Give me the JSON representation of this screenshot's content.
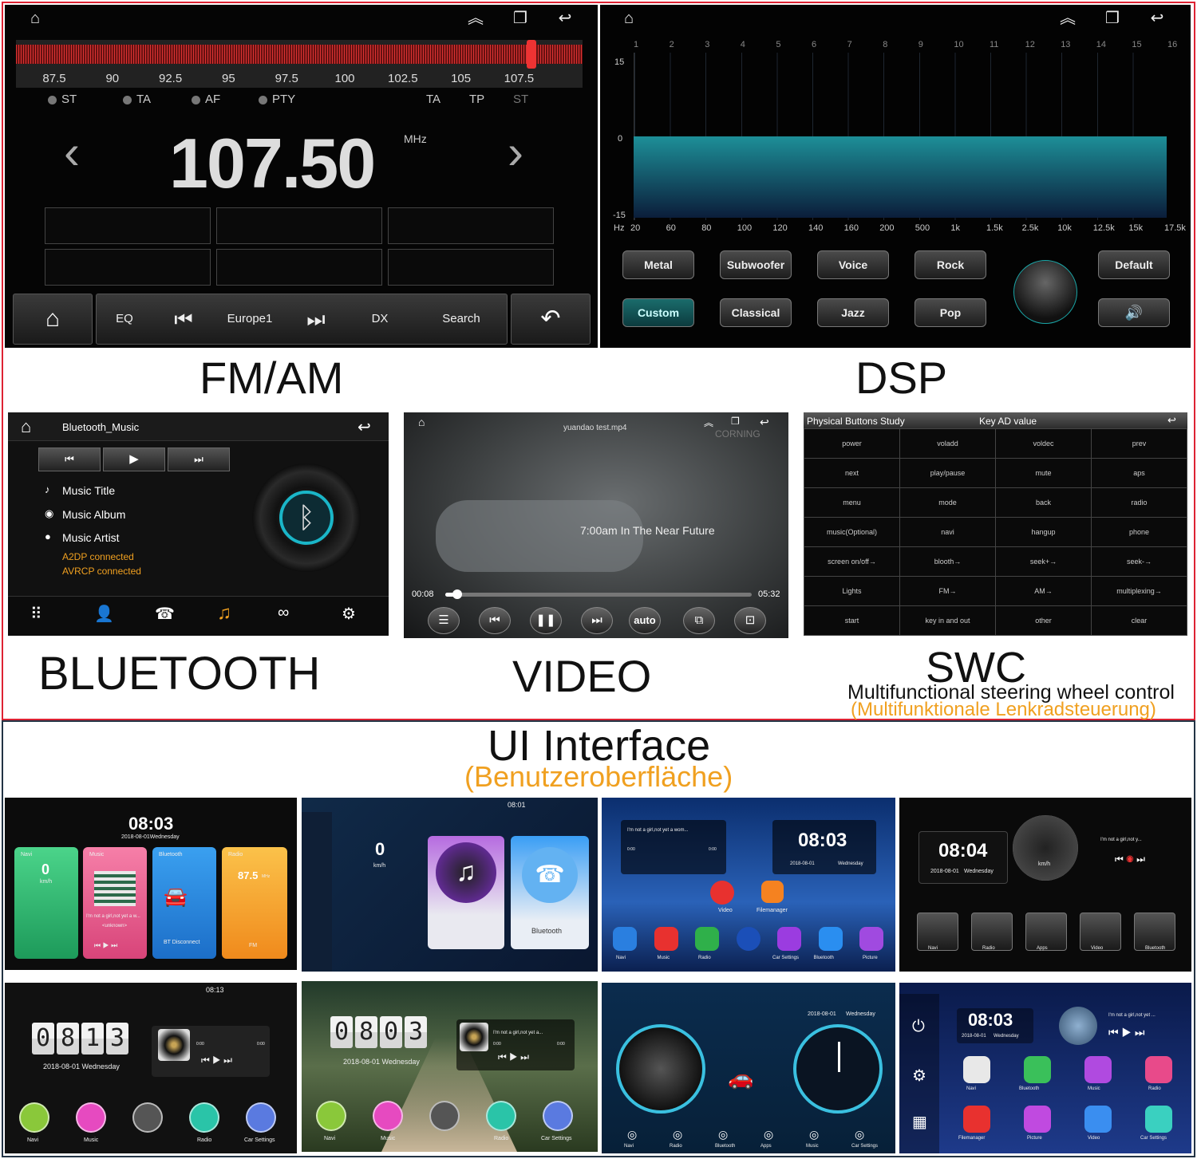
{
  "captions": {
    "fm": "FM/AM",
    "dsp": "DSP",
    "bluetooth": "BLUETOOTH",
    "video": "VIDEO",
    "swc": "SWC",
    "swc_sub": "Multifunctional steering wheel control",
    "swc_sub_de": "(Multifunktionale Lenkradsteuerung)",
    "ui": "UI Interface",
    "ui_de": "(Benutzeroberfläche)"
  },
  "fm": {
    "scale": [
      "87.5",
      "90",
      "92.5",
      "95",
      "97.5",
      "100",
      "102.5",
      "105",
      "107.5"
    ],
    "flags_left": [
      "ST",
      "TA",
      "AF",
      "PTY"
    ],
    "flags_right": [
      "TA",
      "TP",
      "ST"
    ],
    "frequency": "107.50",
    "unit": "MHz",
    "buttons": {
      "eq": "EQ",
      "station": "Europe1",
      "dx": "DX",
      "search": "Search"
    },
    "tuned_fraction": 0.91
  },
  "dsp": {
    "bands": [
      "1",
      "2",
      "3",
      "4",
      "5",
      "6",
      "7",
      "8",
      "9",
      "10",
      "11",
      "12",
      "13",
      "14",
      "15",
      "16"
    ],
    "levels": [
      "15",
      "0",
      "-15"
    ],
    "hz_label": "Hz",
    "freqs": [
      "20",
      "60",
      "80",
      "100",
      "120",
      "140",
      "160",
      "200",
      "500",
      "1k",
      "1.5k",
      "2.5k",
      "10k",
      "12.5k",
      "15k",
      "17.5k"
    ],
    "presets_row1": [
      "Metal",
      "Subwoofer",
      "Voice",
      "Rock"
    ],
    "presets_row2": [
      "Custom",
      "Classical",
      "Jazz",
      "Pop"
    ],
    "default": "Default"
  },
  "bt": {
    "title": "Bluetooth_Music",
    "music_title": "Music Title",
    "music_album": "Music Album",
    "music_artist": "Music Artist",
    "status1": "A2DP connected",
    "status2": "AVRCP connected"
  },
  "video": {
    "file": "yuandao test.mp4",
    "watermark": "CORNING",
    "subtitle": "7:00am In The Near Future",
    "elapsed": "00:08",
    "total": "05:32",
    "auto": "auto",
    "progress": 0.04
  },
  "swc": {
    "header_left": "Physical Buttons Study",
    "header_mid": "Key AD value",
    "rows": [
      [
        "power",
        "voladd",
        "voldec",
        "prev"
      ],
      [
        "next",
        "play/pause",
        "mute",
        "aps"
      ],
      [
        "menu",
        "mode",
        "back",
        "radio"
      ],
      [
        "music(Optional)",
        "navi",
        "hangup",
        "phone"
      ],
      [
        "screen on/off→",
        "blooth→",
        "seek+→",
        "seek-→"
      ],
      [
        "Lights",
        "FM→",
        "AM→",
        "multiplexing→"
      ],
      [
        "start",
        "key in and out",
        "other",
        "clear"
      ]
    ]
  },
  "thumbs": {
    "t1": {
      "time": "08:03",
      "date": "2018-08-01Wednesday",
      "cards": [
        "Navi",
        "Music",
        "Bluetooth",
        "Radio"
      ],
      "speed": "0",
      "speed_unit": "km/h",
      "song": "I'm not a girl,not yet a w...",
      "artist": "<unknown>",
      "bt_status": "BT Disconnect",
      "radio_freq": "87.5",
      "radio_unit": "MHz",
      "fm": "FM"
    },
    "t2": {
      "time": "08:01",
      "speed": "0",
      "speed_unit": "km/h",
      "bt": "Bluetooth"
    },
    "t3": {
      "song": "I'm not a girl,not yet a wom...",
      "t0": "0:00",
      "t1": "0:00",
      "time": "08:03",
      "date": "2018-08-01",
      "day": "Wednesday",
      "top": [
        "Video",
        "Filemanager"
      ],
      "dock": [
        "Navi",
        "Music",
        "Radio",
        "",
        "Car Settings",
        "Bluetooth",
        "Picture"
      ]
    },
    "t4": {
      "time": "08:04",
      "date": "2018-08-01",
      "day": "Wednesday",
      "song": "I'm not a girl,not y...",
      "unit": "km/h",
      "dock": [
        "Navi",
        "Radio",
        "Apps",
        "Video",
        "Bluetooth"
      ]
    },
    "t5": {
      "time": "08:13",
      "clock": [
        "0",
        "8",
        "1",
        "3"
      ],
      "date": "2018-08-01 Wednesday",
      "t0": "0:00",
      "t1": "0:00",
      "dock": [
        "Navi",
        "Music",
        "",
        "Radio",
        "Car Settings"
      ]
    },
    "t6": {
      "clock": [
        "0",
        "8",
        "0",
        "3"
      ],
      "date": "2018-08-01 Wednesday",
      "song": "I'm not a girl,not yet a...",
      "t0": "0:00",
      "t1": "0:00",
      "dock": [
        "Navi",
        "Music",
        "",
        "Radio",
        "Car Settings"
      ]
    },
    "t7": {
      "date": "2018-08-01",
      "day": "Wednesday",
      "dock": [
        "Navi",
        "Radio",
        "Bluetooth",
        "Apps",
        "Music",
        "Car Settings"
      ]
    },
    "t8": {
      "time": "08:03",
      "date": "2018-08-01",
      "day": "Wednesday",
      "song": "I'm not a girl,not yet ...",
      "apps": [
        "Navi",
        "Bluetooth",
        "Music",
        "Radio",
        "Filemanager",
        "Picture",
        "Video",
        "Car Settings"
      ]
    }
  },
  "colors": {
    "fm_red": "#d2252a",
    "teal": "#1aa7a8",
    "orange": "#f0a020"
  }
}
